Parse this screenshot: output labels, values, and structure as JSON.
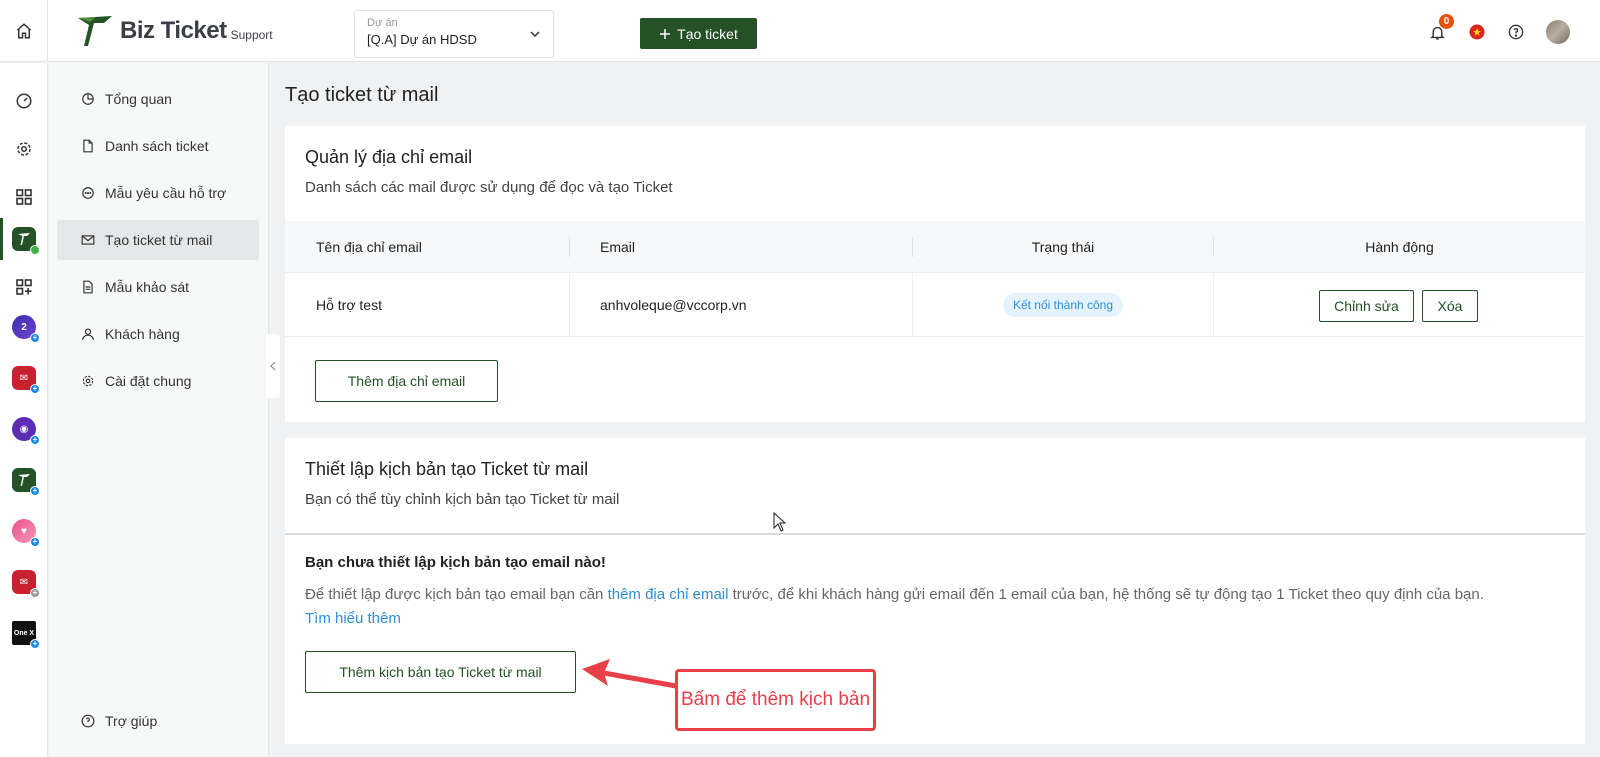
{
  "header": {
    "logo_main": "Biz Ticket",
    "logo_sub": "Support",
    "project_label": "Dự án",
    "project_value": "[Q.A] Dự án HDSD",
    "create_button": "Tạo ticket",
    "notification_count": "0"
  },
  "rail": {
    "apps": [
      "gauge-icon",
      "gear-icon",
      "grid-icon",
      "bizticket-app",
      "grid-plus-icon",
      "app-2",
      "app-mail",
      "app-bot",
      "app-bizticket",
      "app-heart",
      "app-mail-2",
      "app-onex"
    ],
    "onex_label": "One X"
  },
  "nav": {
    "items": [
      {
        "label": "Tổng quan"
      },
      {
        "label": "Danh sách ticket"
      },
      {
        "label": "Mẫu yêu cầu hỗ trợ"
      },
      {
        "label": "Tạo ticket từ mail"
      },
      {
        "label": "Mẫu khảo sát"
      },
      {
        "label": "Khách hàng"
      },
      {
        "label": "Cài đặt chung"
      }
    ],
    "help": "Trợ giúp"
  },
  "main": {
    "page_title": "Tạo ticket từ mail",
    "email_card": {
      "title": "Quản lý địa chỉ email",
      "subtitle": "Danh sách các mail được sử dụng để đọc và tạo Ticket",
      "columns": [
        "Tên địa chỉ email",
        "Email",
        "Trạng thái",
        "Hành động"
      ],
      "rows": [
        {
          "name": "Hỗ trợ test",
          "email": "anhvoleque@vccorp.vn",
          "status": "Kết nối thành công",
          "edit": "Chỉnh sửa",
          "delete": "Xóa"
        }
      ],
      "add_button": "Thêm địa chỉ email"
    },
    "script_card": {
      "title": "Thiết lập kịch bản tạo Ticket từ mail",
      "subtitle": "Bạn có thể tùy chỉnh kịch bản tạo Ticket từ mail",
      "empty_title": "Bạn chưa thiết lập kịch bản tạo email nào!",
      "desc_before": "Để thiết lập được kịch bản tạo email bạn cần ",
      "desc_link": "thêm địa chỉ email",
      "desc_after": " trước, để khi khách hàng gửi email đến 1 email của bạn, hệ thống sẽ tự động tạo 1 Ticket theo quy định của bạn.",
      "learn_more": "Tìm hiểu thêm",
      "add_button": "Thêm kịch bản tạo Ticket từ mail"
    }
  },
  "annotation": {
    "text": "Bấm để thêm kịch bản"
  },
  "colors": {
    "primary": "#245126",
    "link": "#2d8fd5",
    "annotation": "#e8404a",
    "badge": "#e8510d"
  }
}
